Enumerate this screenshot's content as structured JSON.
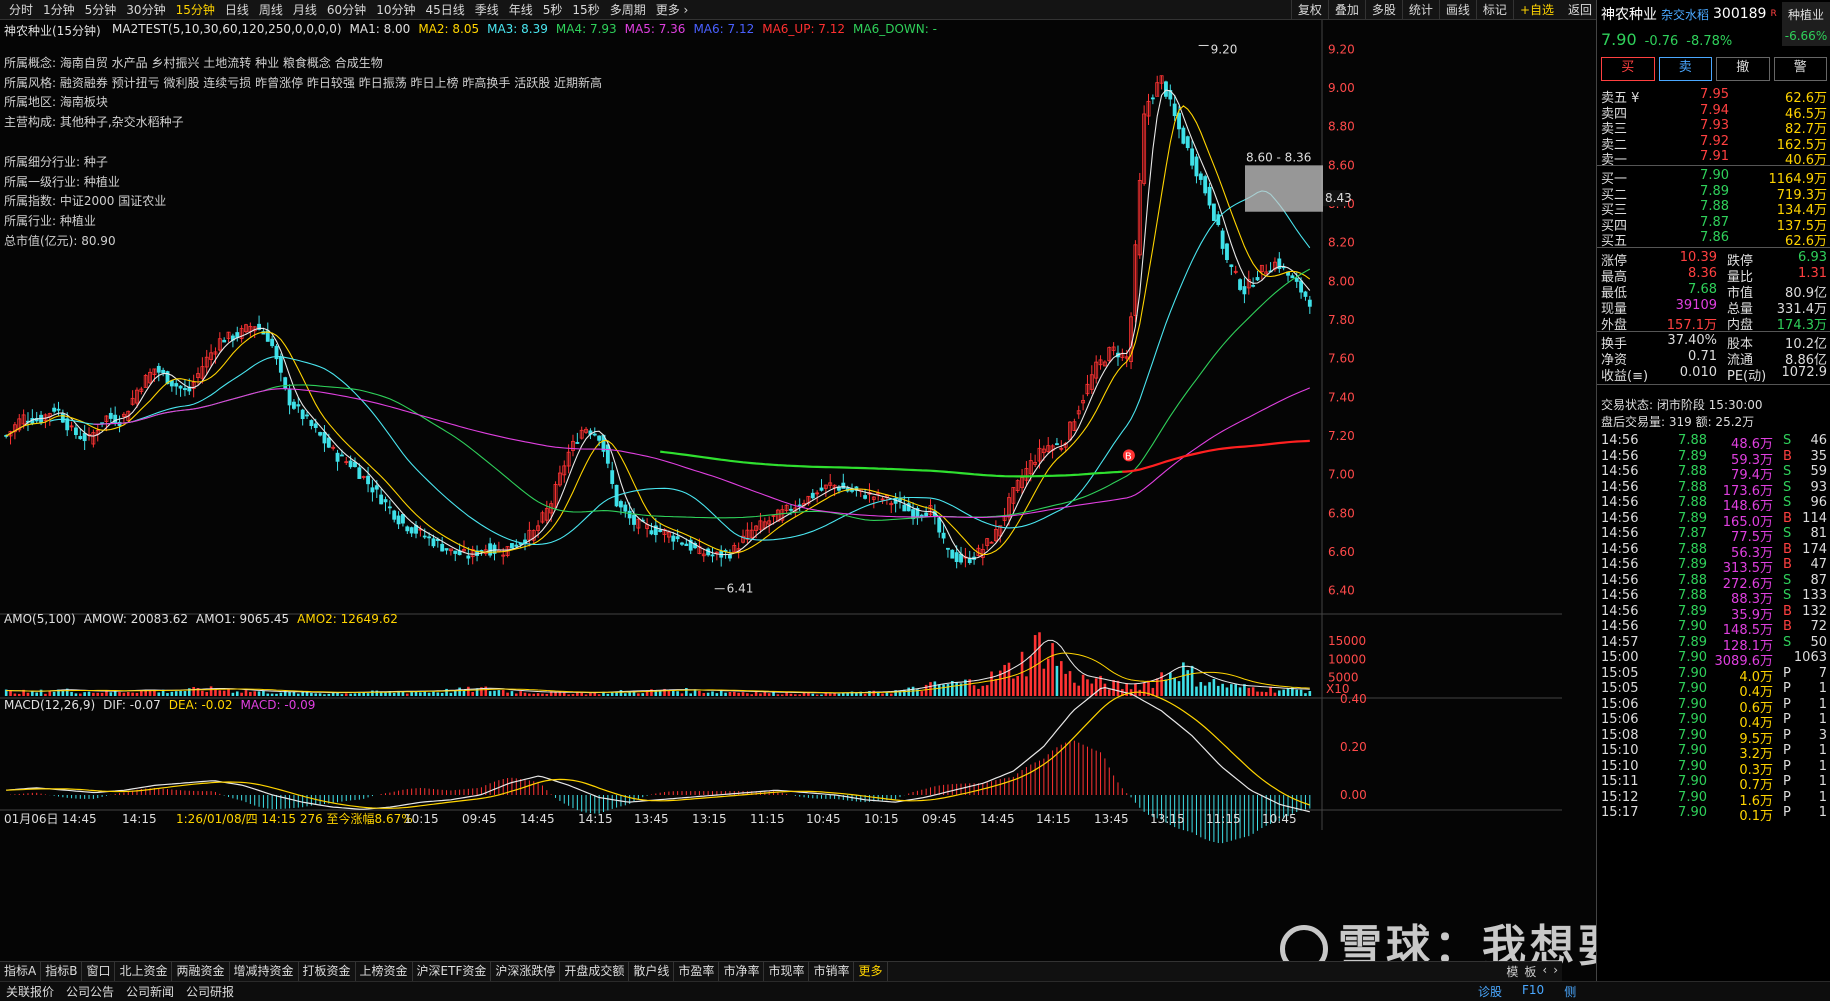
{
  "toolbar": {
    "periods": [
      "分时",
      "1分钟",
      "5分钟",
      "30分钟",
      "15分钟",
      "日线",
      "周线",
      "月线",
      "60分钟",
      "10分钟",
      "45日线",
      "季线",
      "年线",
      "5秒",
      "15秒",
      "多周期",
      "更多 ›"
    ],
    "active_period": 4,
    "right_tools": [
      "复权",
      "叠加",
      "多股",
      "统计",
      "画线",
      "标记"
    ],
    "add_fav": "+自选",
    "back": "返回"
  },
  "chart": {
    "stock_period": "神农种业(15分钟)",
    "ma_legend": [
      {
        "text": "MA2TEST(5,10,30,60,120,250,0,0,0,0)",
        "color": "#e0e0e0"
      },
      {
        "text": "MA1: 8.00",
        "color": "#e0e0e0"
      },
      {
        "text": "MA2: 8.05",
        "color": "#ffd400"
      },
      {
        "text": "MA3: 8.39",
        "color": "#4ae6f0"
      },
      {
        "text": "MA4: 7.93",
        "color": "#2fd05a"
      },
      {
        "text": "MA5: 7.36",
        "color": "#e040e0"
      },
      {
        "text": "MA6: 7.12",
        "color": "#4a60ff"
      },
      {
        "text": "MA6_UP: 7.12",
        "color": "#ff3030"
      },
      {
        "text": "MA6_DOWN: -",
        "color": "#2fd05a"
      }
    ],
    "info_lines": [
      "所属概念: 海南自贸 水产品 乡村振兴 土地流转 种业 粮食概念 合成生物",
      "所属风格: 融资融券 预计扭亏 微利股 连续亏损 昨曾涨停 昨日较强 昨日振荡 昨日上榜 昨高换手 活跃股 近期新高",
      "所属地区: 海南板块",
      "主营构成: 其他种子,杂交水稻种子",
      "",
      "所属细分行业: 种子",
      "所属一级行业: 种植业",
      "所属指数: 中证2000 国证农业",
      "所属行业: 种植业",
      "总市值(亿元): 80.90"
    ],
    "price_axis": [
      "9.20",
      "9.00",
      "8.80",
      "8.60",
      "8.40",
      "8.20",
      "8.00",
      "7.80",
      "7.60",
      "7.40",
      "7.20",
      "7.00",
      "6.80",
      "6.60",
      "6.40"
    ],
    "high_label": "9.20",
    "low_label": "6.41",
    "range_label": "8.60 - 8.36",
    "cursor_price": "8.43",
    "b_marker": "B",
    "vol_legend": [
      {
        "text": "AMO(5,100)",
        "color": "#e0e0e0"
      },
      {
        "text": "AMOW: 20083.62",
        "color": "#e0e0e0"
      },
      {
        "text": "AMO1: 9065.45",
        "color": "#e0e0e0"
      },
      {
        "text": "AMO2: 12649.62",
        "color": "#ffd400"
      }
    ],
    "vol_axis": [
      "15000",
      "10000",
      "5000"
    ],
    "vol_unit": "X10",
    "macd_legend": [
      {
        "text": "MACD(12,26,9)",
        "color": "#e0e0e0"
      },
      {
        "text": "DIF: -0.07",
        "color": "#e0e0e0"
      },
      {
        "text": "DEA: -0.02",
        "color": "#ffd400"
      },
      {
        "text": "MACD: -0.09",
        "color": "#e040e0"
      }
    ],
    "macd_axis": [
      "0.40",
      "0.20",
      "0.00"
    ],
    "time_axis": [
      "01月06日",
      "14:45",
      "14:15",
      "1:26/01/08/四 14:15 276 至今涨幅8.67%",
      "10:15",
      "09:45",
      "14:45",
      "14:15",
      "13:45",
      "13:15",
      "11:15",
      "10:45",
      "10:15",
      "09:45",
      "14:45",
      "14:15",
      "13:45",
      "13:15",
      "11:15",
      "10:45"
    ]
  },
  "bottom_tabs": [
    "指标A",
    "指标B",
    "窗口",
    "北上资金",
    "两融资金",
    "增减持资金",
    "打板资金",
    "上榜资金",
    "沪深ETF资金",
    "沪深涨跌停",
    "开盘成交额",
    "散户线",
    "市盈率",
    "市净率",
    "市现率",
    "市销率",
    "更多"
  ],
  "bottom_tabs_right": [
    "模",
    "板",
    "‹",
    "›"
  ],
  "nav_links": [
    "关联报价",
    "公司公告",
    "公司新闻",
    "公司研报"
  ],
  "status_right": [
    "诊股",
    "F10",
    "侧"
  ],
  "watermark": "雪球：我想要潇洒",
  "quote": {
    "name": "神农种业",
    "concept": "杂交水稻",
    "code": "300189",
    "r_badge": "R",
    "industry": "种植业",
    "industry_pct": "-6.66%",
    "price": "7.90",
    "change": "-0.76",
    "change_pct": "-8.78%",
    "buttons": [
      "买",
      "卖",
      "撤",
      "警"
    ],
    "asks": [
      {
        "label": "卖五 ¥",
        "price": "7.95",
        "vol": "62.6万",
        "pc": "red"
      },
      {
        "label": "卖四",
        "price": "7.94",
        "vol": "46.5万",
        "pc": "red"
      },
      {
        "label": "卖三",
        "price": "7.93",
        "vol": "82.7万",
        "pc": "red"
      },
      {
        "label": "卖二",
        "price": "7.92",
        "vol": "162.5万",
        "pc": "red"
      },
      {
        "label": "卖一",
        "price": "7.91",
        "vol": "40.6万",
        "pc": "red"
      }
    ],
    "bids": [
      {
        "label": "买一",
        "price": "7.90",
        "vol": "1164.9万",
        "pc": "green"
      },
      {
        "label": "买二",
        "price": "7.89",
        "vol": "719.3万",
        "pc": "green"
      },
      {
        "label": "买三",
        "price": "7.88",
        "vol": "134.4万",
        "pc": "green"
      },
      {
        "label": "买四",
        "price": "7.87",
        "vol": "137.5万",
        "pc": "green"
      },
      {
        "label": "买五",
        "price": "7.86",
        "vol": "62.6万",
        "pc": "green"
      }
    ],
    "stats": [
      {
        "l1": "涨停",
        "v1": "10.39",
        "c1": "red",
        "l2": "跌停",
        "v2": "6.93",
        "c2": "green"
      },
      {
        "l1": "最高",
        "v1": "8.36",
        "c1": "red",
        "l2": "量比",
        "v2": "1.31",
        "c2": "red"
      },
      {
        "l1": "最低",
        "v1": "7.68",
        "c1": "green",
        "l2": "市值",
        "v2": "80.9亿",
        "c2": "white"
      },
      {
        "l1": "现量",
        "v1": "39109",
        "c1": "magenta",
        "l2": "总量",
        "v2": "331.4万",
        "c2": "white"
      },
      {
        "l1": "外盘",
        "v1": "157.1万",
        "c1": "red",
        "l2": "内盘",
        "v2": "174.3万",
        "c2": "green"
      },
      {
        "l1": "换手",
        "v1": "37.40%",
        "c1": "white",
        "l2": "股本",
        "v2": "10.2亿",
        "c2": "white"
      },
      {
        "l1": "净资",
        "v1": "0.71",
        "c1": "white",
        "l2": "流通",
        "v2": "8.86亿",
        "c2": "white"
      },
      {
        "l1": "收益(≡)",
        "v1": "0.010",
        "c1": "white",
        "l2": "PE(动)",
        "v2": "1072.9",
        "c2": "white"
      }
    ],
    "trade_status": "交易状态: 闭市阶段 15:30:00",
    "after_hours": "盘后交易量: 319  额: 25.2万",
    "ticks": [
      {
        "t": "14:56",
        "p": "7.88",
        "v": "48.6万",
        "d": "S",
        "n": "46",
        "vc": "magenta"
      },
      {
        "t": "14:56",
        "p": "7.89",
        "v": "59.3万",
        "d": "B",
        "n": "35",
        "vc": "magenta"
      },
      {
        "t": "14:56",
        "p": "7.88",
        "v": "79.4万",
        "d": "S",
        "n": "59",
        "vc": "magenta"
      },
      {
        "t": "14:56",
        "p": "7.88",
        "v": "173.6万",
        "d": "S",
        "n": "93",
        "vc": "magenta"
      },
      {
        "t": "14:56",
        "p": "7.88",
        "v": "148.6万",
        "d": "S",
        "n": "96",
        "vc": "magenta"
      },
      {
        "t": "14:56",
        "p": "7.89",
        "v": "165.0万",
        "d": "B",
        "n": "114",
        "vc": "magenta"
      },
      {
        "t": "14:56",
        "p": "7.87",
        "v": "77.5万",
        "d": "S",
        "n": "81",
        "vc": "magenta"
      },
      {
        "t": "14:56",
        "p": "7.88",
        "v": "56.3万",
        "d": "B",
        "n": "174",
        "vc": "magenta"
      },
      {
        "t": "14:56",
        "p": "7.89",
        "v": "313.5万",
        "d": "B",
        "n": "47",
        "vc": "magenta"
      },
      {
        "t": "14:56",
        "p": "7.88",
        "v": "272.6万",
        "d": "S",
        "n": "87",
        "vc": "magenta"
      },
      {
        "t": "14:56",
        "p": "7.88",
        "v": "88.3万",
        "d": "S",
        "n": "133",
        "vc": "magenta"
      },
      {
        "t": "14:56",
        "p": "7.89",
        "v": "35.9万",
        "d": "B",
        "n": "132",
        "vc": "magenta"
      },
      {
        "t": "14:56",
        "p": "7.90",
        "v": "148.5万",
        "d": "B",
        "n": "72",
        "vc": "magenta"
      },
      {
        "t": "14:57",
        "p": "7.89",
        "v": "128.1万",
        "d": "S",
        "n": "50",
        "vc": "magenta"
      },
      {
        "t": "15:00",
        "p": "7.90",
        "v": "3089.6万",
        "d": "",
        "n": "1063",
        "vc": "magenta"
      },
      {
        "t": "15:05",
        "p": "7.90",
        "v": "4.0万",
        "d": "P",
        "n": "7",
        "vc": "yellow"
      },
      {
        "t": "15:05",
        "p": "7.90",
        "v": "0.4万",
        "d": "P",
        "n": "1",
        "vc": "yellow"
      },
      {
        "t": "15:06",
        "p": "7.90",
        "v": "0.6万",
        "d": "P",
        "n": "1",
        "vc": "yellow"
      },
      {
        "t": "15:06",
        "p": "7.90",
        "v": "0.4万",
        "d": "P",
        "n": "1",
        "vc": "yellow"
      },
      {
        "t": "15:08",
        "p": "7.90",
        "v": "9.5万",
        "d": "P",
        "n": "3",
        "vc": "yellow"
      },
      {
        "t": "15:10",
        "p": "7.90",
        "v": "3.2万",
        "d": "P",
        "n": "1",
        "vc": "yellow"
      },
      {
        "t": "15:10",
        "p": "7.90",
        "v": "0.3万",
        "d": "P",
        "n": "1",
        "vc": "yellow"
      },
      {
        "t": "15:11",
        "p": "7.90",
        "v": "0.7万",
        "d": "P",
        "n": "1",
        "vc": "yellow"
      },
      {
        "t": "15:12",
        "p": "7.90",
        "v": "1.6万",
        "d": "P",
        "n": "1",
        "vc": "yellow"
      },
      {
        "t": "15:17",
        "p": "7.90",
        "v": "0.1万",
        "d": "P",
        "n": "1",
        "vc": "yellow"
      }
    ]
  },
  "chart_data": {
    "type": "candlestick",
    "title": "神农种业(15分钟)",
    "ylim": [
      6.3,
      9.3
    ],
    "close_keypoints": [
      7.2,
      7.3,
      7.28,
      7.35,
      7.22,
      7.18,
      7.3,
      7.28,
      7.45,
      7.55,
      7.48,
      7.42,
      7.58,
      7.7,
      7.72,
      7.78,
      7.7,
      7.4,
      7.3,
      7.2,
      7.1,
      7.05,
      6.95,
      6.85,
      6.75,
      6.7,
      6.65,
      6.6,
      6.58,
      6.62,
      6.6,
      6.65,
      6.7,
      6.85,
      7.1,
      7.25,
      7.2,
      6.85,
      6.75,
      6.72,
      6.7,
      6.65,
      6.6,
      6.58,
      6.6,
      6.7,
      6.75,
      6.8,
      6.85,
      6.9,
      6.95,
      6.92,
      6.9,
      6.88,
      6.85,
      6.8,
      6.82,
      6.6,
      6.55,
      6.6,
      6.7,
      6.9,
      7.05,
      7.15,
      7.15,
      7.35,
      7.55,
      7.65,
      7.6,
      8.9,
      9.05,
      8.8,
      8.6,
      8.4,
      8.1,
      7.95,
      8.05,
      8.1,
      8.0,
      7.9
    ],
    "amo_keypoints": [
      1500,
      1200,
      1800,
      1400,
      1300,
      1700,
      1500,
      1900,
      2100,
      1600,
      1200,
      1100,
      900,
      1000,
      1200,
      1300,
      1400,
      1800,
      2200,
      1500,
      1100,
      1000,
      900,
      1300,
      1500,
      1800,
      1600,
      1400,
      1200,
      1000,
      900,
      800,
      1000,
      1200,
      2000,
      3500,
      4000,
      5500,
      9500,
      17000,
      6000,
      4500,
      3000,
      4500,
      9000,
      5000,
      3000,
      2500,
      2000,
      1800
    ],
    "dif_keypoints": [
      0.02,
      0.03,
      0.02,
      0.01,
      0.02,
      0.04,
      0.05,
      0.06,
      0.04,
      0.0,
      -0.03,
      -0.05,
      -0.06,
      -0.05,
      -0.03,
      -0.02,
      0.0,
      0.05,
      0.08,
      0.04,
      -0.01,
      -0.03,
      -0.02,
      -0.01,
      0.0,
      0.01,
      0.02,
      0.01,
      0.0,
      -0.02,
      -0.03,
      -0.01,
      0.02,
      0.05,
      0.1,
      0.2,
      0.35,
      0.45,
      0.42,
      0.35,
      0.25,
      0.12,
      0.02,
      -0.04,
      -0.07
    ]
  }
}
